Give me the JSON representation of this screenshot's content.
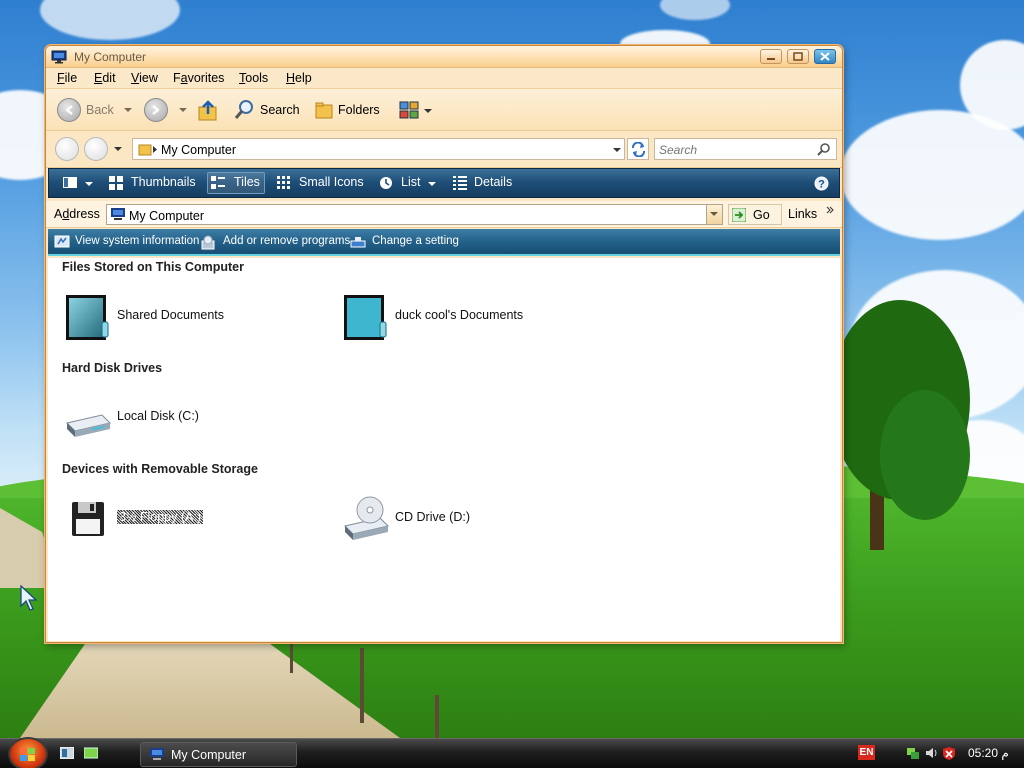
{
  "window": {
    "title": "My Computer",
    "menu": [
      {
        "label": "File",
        "accel": "F",
        "rest": "ile"
      },
      {
        "label": "Edit",
        "accel": "E",
        "rest": "dit"
      },
      {
        "label": "View",
        "accel": "V",
        "rest": "iew"
      },
      {
        "label": "Favorites",
        "accel": "a",
        "pre": "F",
        "rest": "vorites"
      },
      {
        "label": "Tools",
        "accel": "T",
        "rest": "ools"
      },
      {
        "label": "Help",
        "accel": "H",
        "rest": "elp"
      }
    ],
    "toolbar": {
      "back_label": "Back",
      "search_label": "Search",
      "folders_label": "Folders"
    },
    "navbar": {
      "breadcrumb": "My Computer",
      "search_placeholder": "Search"
    },
    "viewbar": {
      "thumbnails": "Thumbnails",
      "tiles": "Tiles",
      "small_icons": "Small Icons",
      "list": "List",
      "details": "Details"
    },
    "address": {
      "label_accel": "d",
      "label_pre": "A",
      "label_rest": "dress",
      "value": "My Computer",
      "go_label": "Go",
      "links_label": "Links"
    },
    "tasks": {
      "system_info": "View system information",
      "add_remove": "Add or remove programs",
      "change_setting": "Change a setting"
    },
    "groups": {
      "files": {
        "header": "Files Stored on This Computer",
        "items": [
          "Shared Documents",
          "duck cool's Documents"
        ]
      },
      "drives": {
        "header": "Hard Disk Drives",
        "items": [
          "Local Disk (C:)"
        ]
      },
      "removable": {
        "header": "Devices with Removable Storage",
        "items": [
          "3½ Floppy (A:)",
          "CD Drive (D:)"
        ]
      }
    }
  },
  "taskbar": {
    "active_window": "My Computer",
    "language": "EN",
    "clock": "05:20 م"
  },
  "colors": {
    "window_frame": "#fbe7c4",
    "viewbar": "#1d4d76",
    "taskbar": "#1e1e1e",
    "accent_teal": "#66d3e0"
  }
}
